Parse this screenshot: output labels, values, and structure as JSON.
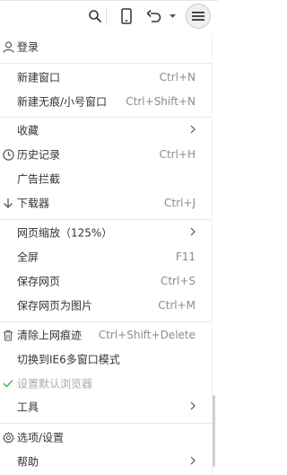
{
  "menu": {
    "login": "登录",
    "new_window": "新建窗口",
    "new_window_shortcut": "Ctrl+N",
    "new_private": "新建无痕/小号窗口",
    "new_private_shortcut": "Ctrl+Shift+N",
    "favorites": "收藏",
    "history": "历史记录",
    "history_shortcut": "Ctrl+H",
    "ad_block": "广告拦截",
    "downloads": "下载器",
    "downloads_shortcut": "Ctrl+J",
    "zoom": "网页缩放（125%）",
    "fullscreen": "全屏",
    "fullscreen_shortcut": "F11",
    "save_page": "保存网页",
    "save_page_shortcut": "Ctrl+S",
    "save_as_image": "保存网页为图片",
    "save_as_image_shortcut": "Ctrl+M",
    "clear_traces": "清除上网痕迹",
    "clear_traces_shortcut": "Ctrl+Shift+Delete",
    "ie6_mode": "切换到IE6多窗口模式",
    "set_default": "设置默认浏览器",
    "tools": "工具",
    "options": "选项/设置",
    "help": "帮助"
  },
  "icons": {
    "search": "search-icon",
    "mobile": "mobile-icon",
    "undo": "undo-icon",
    "menu": "hamburger-menu-icon"
  },
  "colors": {
    "check": "#5cb85c",
    "shortcut": "#8c8c8c",
    "disabled": "#aaaaaa"
  }
}
